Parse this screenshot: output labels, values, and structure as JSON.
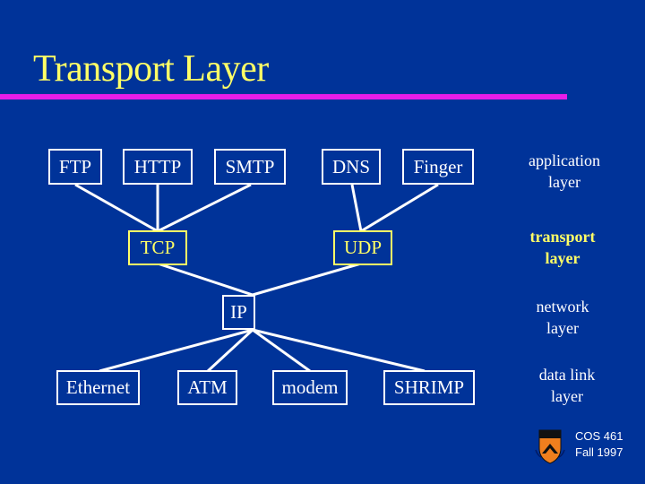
{
  "title": "Transport Layer",
  "colors": {
    "background": "#003399",
    "title": "#ffff66",
    "rule": "#e81de8",
    "box": "#ffffff",
    "highlight": "#ffff66"
  },
  "application_protocols": [
    "FTP",
    "HTTP",
    "SMTP",
    "DNS",
    "Finger"
  ],
  "transport_protocols": [
    "TCP",
    "UDP"
  ],
  "network_protocols": [
    "IP"
  ],
  "datalink_protocols": [
    "Ethernet",
    "ATM",
    "modem",
    "SHRIMP"
  ],
  "layers": {
    "application": {
      "line1": "application",
      "line2": "layer"
    },
    "transport": {
      "line1": "transport",
      "line2": "layer"
    },
    "network": {
      "line1": "network",
      "line2": "layer"
    },
    "datalink": {
      "line1": "data link",
      "line2": "layer"
    }
  },
  "footer": {
    "course": "COS 461",
    "term": "Fall 1997",
    "logo_icon": "university-crest-icon"
  }
}
